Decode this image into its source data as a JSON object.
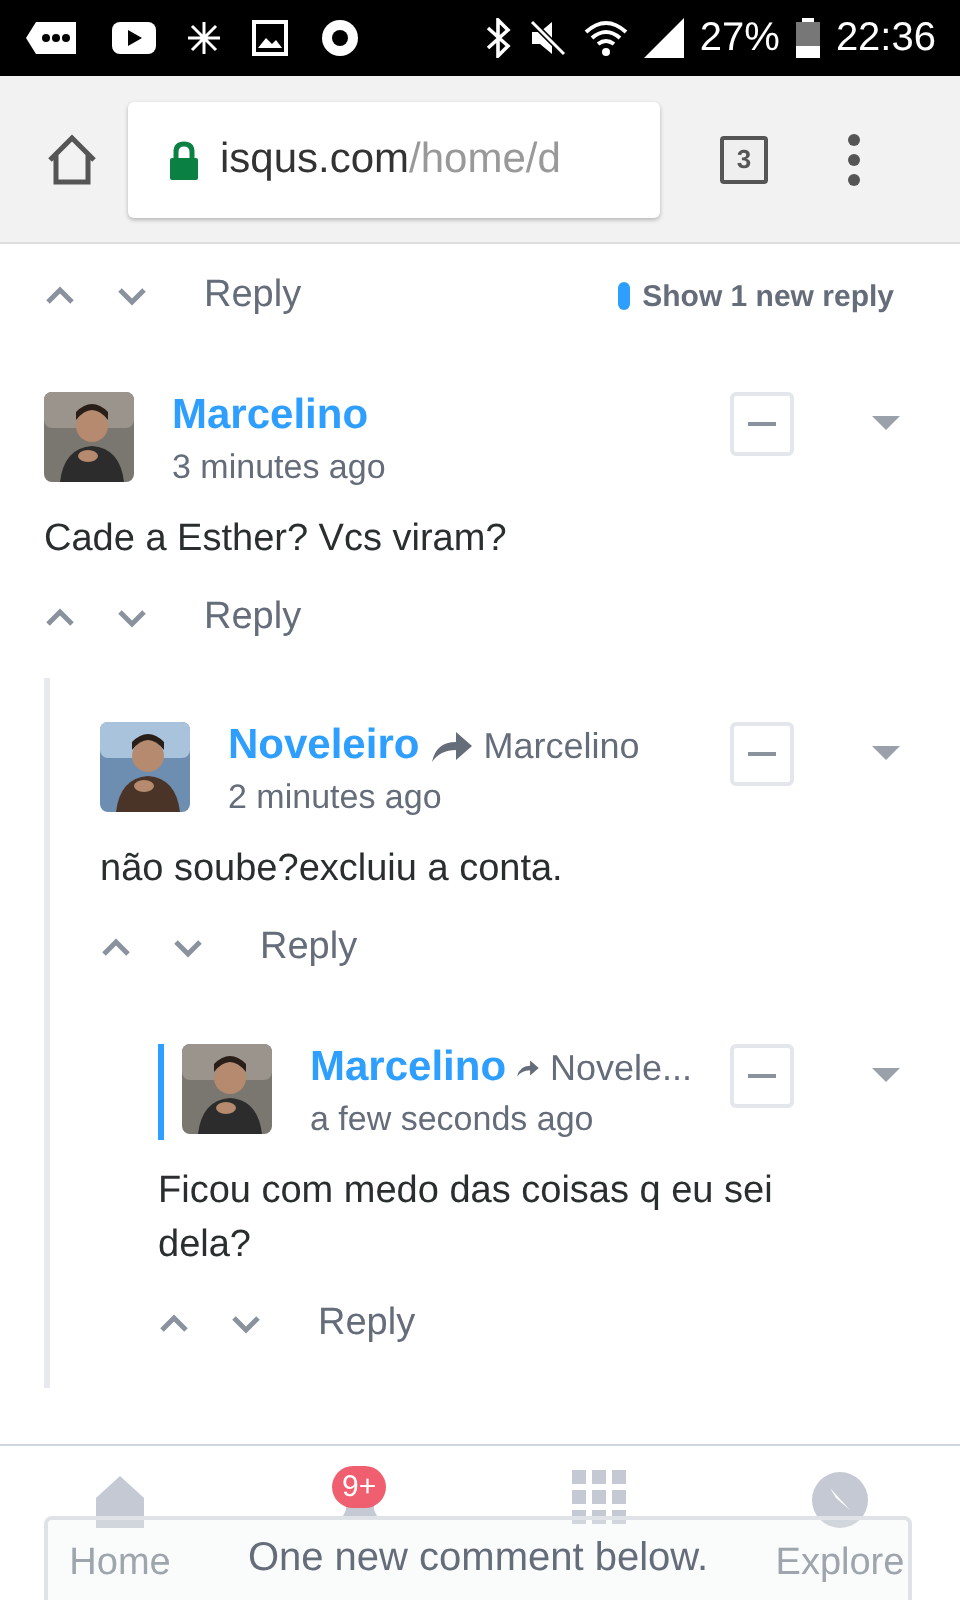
{
  "status_bar": {
    "battery": "27%",
    "time": "22:36"
  },
  "browser": {
    "url_host": "isqus.com",
    "url_path": "/home/d",
    "tab_count": "3"
  },
  "thread_top": {
    "reply": "Reply",
    "new_replies": "Show 1 new reply"
  },
  "comments": [
    {
      "author": "Marcelino",
      "time": "3 minutes ago",
      "text": "Cade a Esther? Vcs viram?",
      "reply": "Reply",
      "highlighted": false,
      "children": [
        {
          "author": "Noveleiro",
          "reply_to": "Marcelino",
          "time": "2 minutes ago",
          "text": "não soube?excluiu a conta.",
          "reply": "Reply",
          "highlighted": false,
          "children": [
            {
              "author": "Marcelino",
              "reply_to": "Novele...",
              "time": "a few seconds ago",
              "text": "Ficou com medo das coisas q eu sei dela?",
              "reply": "Reply",
              "highlighted": true
            }
          ]
        }
      ]
    }
  ],
  "bottom_nav": [
    {
      "kind": "home",
      "label": "Home"
    },
    {
      "kind": "notifications",
      "badge": "9+"
    },
    {
      "kind": "channels"
    },
    {
      "kind": "explore",
      "label": "Explore"
    }
  ],
  "toast": "One new comment below."
}
